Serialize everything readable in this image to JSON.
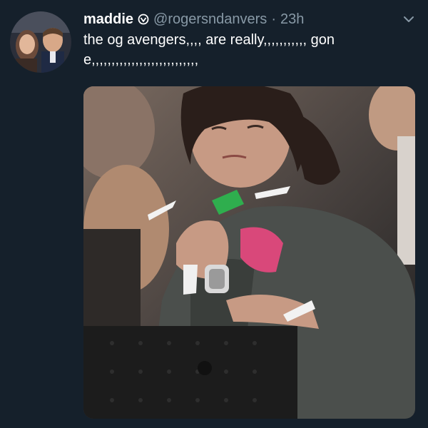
{
  "tweet": {
    "display_name": "maddie",
    "handle": "@rogersndanvers",
    "separator": "·",
    "time": "23h",
    "text": "the og avengers,,,, are really,,,,,,,,,,, gone,,,,,,,,,,,,,,,,,,,,,,,,,,,"
  },
  "icons": {
    "badge": "verified-style-badge-icon",
    "menu": "chevron-down-icon"
  },
  "colors": {
    "background": "#15202b",
    "text_primary": "#ffffff",
    "text_secondary": "#8899a6"
  }
}
